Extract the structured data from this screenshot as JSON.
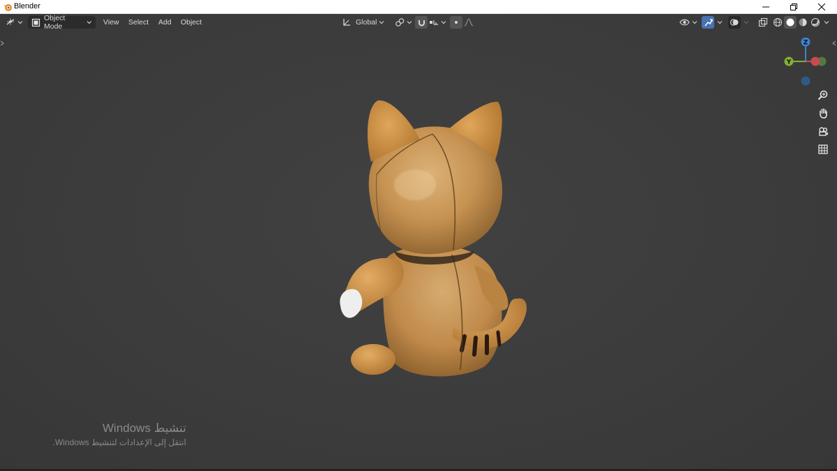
{
  "window": {
    "title": "Blender",
    "logo_icon": "blender-logo-icon",
    "controls": [
      "minimize-icon",
      "restore-icon",
      "close-icon"
    ]
  },
  "header": {
    "editor_type_icon": "editor-type-icon",
    "mode": {
      "label": "Object Mode",
      "icon": "object-mode-icon"
    },
    "menus": [
      {
        "label": "View"
      },
      {
        "label": "Select"
      },
      {
        "label": "Add"
      },
      {
        "label": "Object"
      }
    ],
    "transform_orientation": {
      "label": "Global",
      "icon": "transform-orientation-icon"
    },
    "pivot_icon": "pivot-point-icon",
    "snap_icon": "snap-magnet-icon",
    "snap_target_icon": "snap-target-icon",
    "proportional_icon": "proportional-edit-icon",
    "falloff_icon": "falloff-curve-icon",
    "right_tools": {
      "visibility_icon": "object-visibility-icon",
      "gizmo_icon": "gizmo-toggle-icon",
      "overlay_icon": "overlay-icon",
      "xray_icon": "xray-toggle-icon",
      "shading_modes": [
        "wireframe-shading-icon",
        "solid-shading-icon",
        "material-preview-icon",
        "rendered-shading-icon"
      ],
      "active_shading": "solid-shading-icon"
    }
  },
  "navigation_gizmo": {
    "axes": {
      "x": "",
      "y": "Y",
      "z": "Z"
    },
    "colors": {
      "x": "#c84b53",
      "y": "#82b034",
      "z": "#3d83d0",
      "neg": "#2f5a86"
    }
  },
  "navigation_buttons": [
    "zoom-icon",
    "pan-hand-icon",
    "camera-view-icon",
    "orthographic-grid-icon"
  ],
  "viewport": {
    "background": "#3d3d3d",
    "object": "cat-figurine-model"
  },
  "watermark": {
    "title": "تنشيط Windows",
    "subtitle": "انتقل إلى الإعدادات لتنشيط Windows."
  },
  "colors": {
    "accent": "#4772b3",
    "header_text": "#d8d8d8",
    "dropdown_bg": "#2b2b2b"
  }
}
